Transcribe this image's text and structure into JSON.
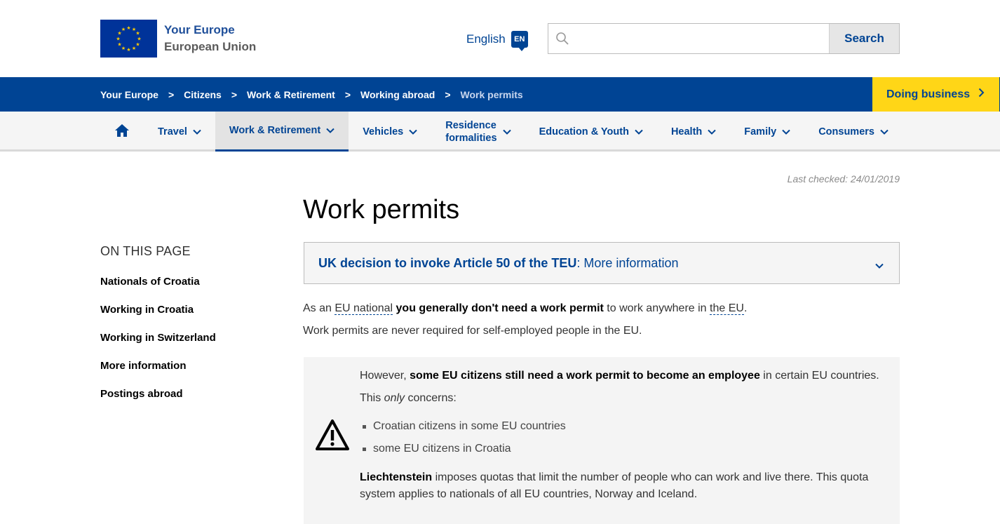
{
  "header": {
    "site_title": "Your Europe",
    "site_subtitle": "European Union",
    "language_label": "English",
    "language_code": "EN",
    "search_placeholder": "",
    "search_button": "Search"
  },
  "breadcrumb": {
    "items": [
      "Your Europe",
      "Citizens",
      "Work & Retirement",
      "Working abroad",
      "Work permits"
    ],
    "separator": ">"
  },
  "doing_business": "Doing business",
  "nav": {
    "items": [
      {
        "label": "Travel"
      },
      {
        "label": "Work & Retirement",
        "active": true
      },
      {
        "label": "Vehicles"
      },
      {
        "label_line1": "Residence",
        "label_line2": "formalities"
      },
      {
        "label": "Education & Youth"
      },
      {
        "label": "Health"
      },
      {
        "label": "Family"
      },
      {
        "label": "Consumers"
      }
    ]
  },
  "content": {
    "last_checked": "Last checked: 24/01/2019",
    "title": "Work permits",
    "toc_title": "ON THIS PAGE",
    "toc": [
      "Nationals of Croatia",
      "Working in Croatia",
      "Working in Switzerland",
      "More information",
      "Postings abroad"
    ],
    "accordion_bold": "UK decision to invoke Article 50 of the TEU",
    "accordion_rest": ": More information",
    "p1_a": "As an ",
    "p1_link1": "EU national",
    "p1_b": " you generally don't need a work permit",
    "p1_c": " to work anywhere in ",
    "p1_link2": "the EU",
    "p1_d": ".",
    "p2": "Work permits are never required for self-employed people in the EU.",
    "warning": {
      "line1_a": "However, ",
      "line1_b": "some EU citizens still need a work permit to become an employee",
      "line1_c": " in certain EU countries.",
      "line2_a": "This ",
      "line2_b": "only",
      "line2_c": " concerns:",
      "bullets": [
        "Croatian citizens in some EU countries",
        "some EU citizens in Croatia"
      ],
      "para_bold": "Liechtenstein",
      "para_rest": " imposes quotas that limit the number of people who can work and live there. This quota system applies to nationals of all EU countries, Norway and Iceland."
    }
  },
  "colors": {
    "primary": "#004494",
    "accent": "#ffd617",
    "flag_blue": "#003399",
    "star_yellow": "#ffcc00"
  }
}
